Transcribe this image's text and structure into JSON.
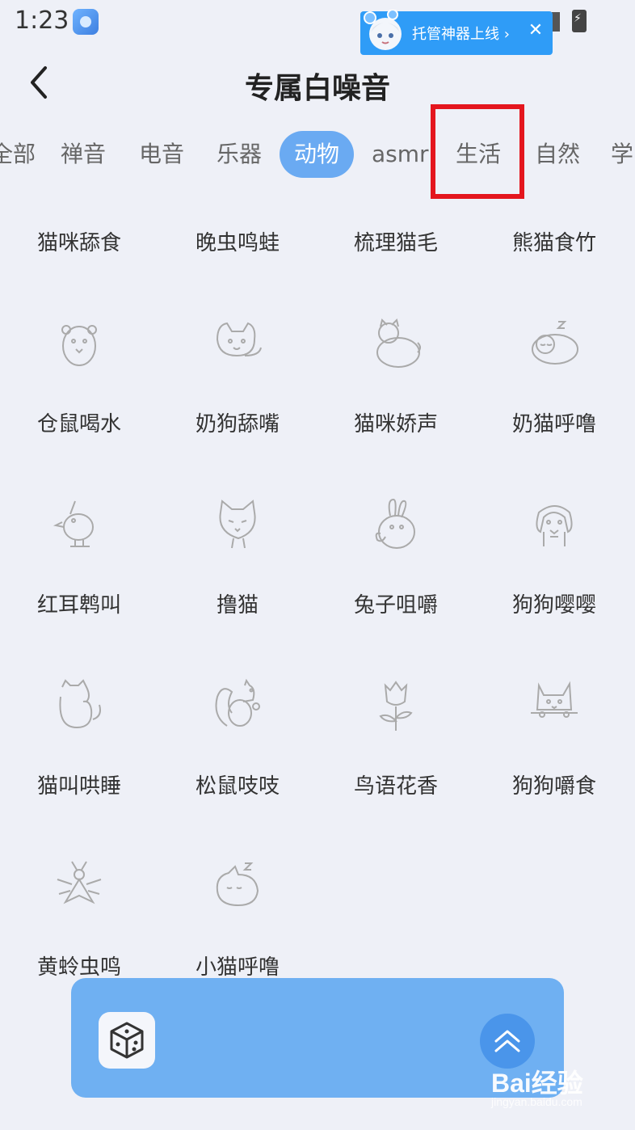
{
  "status_bar": {
    "time": "1:23"
  },
  "promo": {
    "text": "托管神器上线 ›",
    "close": "✕"
  },
  "header": {
    "title": "专属白噪音"
  },
  "tabs": [
    {
      "label": "全部"
    },
    {
      "label": "禅音"
    },
    {
      "label": "电音"
    },
    {
      "label": "乐器"
    },
    {
      "label": "动物",
      "active": true
    },
    {
      "label": "asmr"
    },
    {
      "label": "生活"
    },
    {
      "label": "自然"
    },
    {
      "label": "学"
    }
  ],
  "grid": {
    "items": [
      {
        "label": "猫咪舔食",
        "icon": "cat-eating-icon"
      },
      {
        "label": "晚虫鸣蛙",
        "icon": "frog-icon"
      },
      {
        "label": "梳理猫毛",
        "icon": "cat-grooming-icon"
      },
      {
        "label": "熊猫食竹",
        "icon": "panda-icon"
      },
      {
        "label": "仓鼠喝水",
        "icon": "hamster-icon"
      },
      {
        "label": "奶狗舔嘴",
        "icon": "puppy-icon"
      },
      {
        "label": "猫咪娇声",
        "icon": "cat-sitting-icon"
      },
      {
        "label": "奶猫呼噜",
        "icon": "sleeping-cat-icon"
      },
      {
        "label": "红耳鹎叫",
        "icon": "bird-icon"
      },
      {
        "label": "撸猫",
        "icon": "cat-face-icon"
      },
      {
        "label": "兔子咀嚼",
        "icon": "rabbit-icon"
      },
      {
        "label": "狗狗嘤嘤",
        "icon": "dog-icon"
      },
      {
        "label": "猫叫哄睡",
        "icon": "cat-back-icon"
      },
      {
        "label": "松鼠吱吱",
        "icon": "squirrel-icon"
      },
      {
        "label": "鸟语花香",
        "icon": "flower-icon"
      },
      {
        "label": "狗狗嚼食",
        "icon": "dog-peek-icon"
      },
      {
        "label": "黄蛉虫鸣",
        "icon": "cricket-icon"
      },
      {
        "label": "小猫呼噜",
        "icon": "kitten-sleep-icon"
      }
    ]
  },
  "player": {
    "dice_icon": "dice-icon",
    "expand_icon": "chevron-up-icon"
  },
  "watermark": {
    "logo": "Bai经验",
    "sub": "jingyan.baidu.com"
  },
  "colors": {
    "accent": "#6aaaf2",
    "player_bg": "#6fb0f2",
    "highlight": "#e4161e",
    "background": "#eef0f7"
  }
}
